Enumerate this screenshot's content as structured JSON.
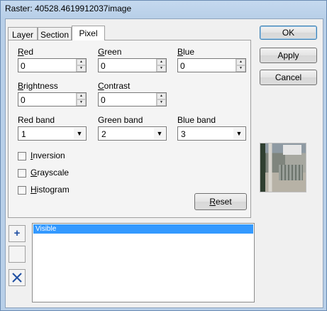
{
  "window": {
    "title": "Raster: 40528.4619912037image"
  },
  "tabs": [
    {
      "label": "Layer",
      "active": false
    },
    {
      "label": "Section",
      "active": false
    },
    {
      "label": "Pixel",
      "active": true
    }
  ],
  "pixel": {
    "red": {
      "label": "Red",
      "value": "0"
    },
    "green": {
      "label": "Green",
      "value": "0"
    },
    "blue": {
      "label": "Blue",
      "value": "0"
    },
    "brightness": {
      "label": "Brightness",
      "value": "0"
    },
    "contrast": {
      "label": "Contrast",
      "value": "0"
    },
    "red_band": {
      "label": "Red band",
      "value": "1"
    },
    "green_band": {
      "label": "Green band",
      "value": "2"
    },
    "blue_band": {
      "label": "Blue band",
      "value": "3"
    },
    "inversion": {
      "label": "Inversion",
      "checked": false
    },
    "grayscale": {
      "label": "Grayscale",
      "checked": false
    },
    "histogram": {
      "label": "Histogram",
      "checked": false
    },
    "reset_label": "Reset"
  },
  "buttons": {
    "ok": "OK",
    "apply": "Apply",
    "cancel": "Cancel"
  },
  "layers": {
    "items": [
      "Visible"
    ]
  },
  "colors": {
    "selection": "#3399ff",
    "default_button_border": "#3c7fb1"
  }
}
